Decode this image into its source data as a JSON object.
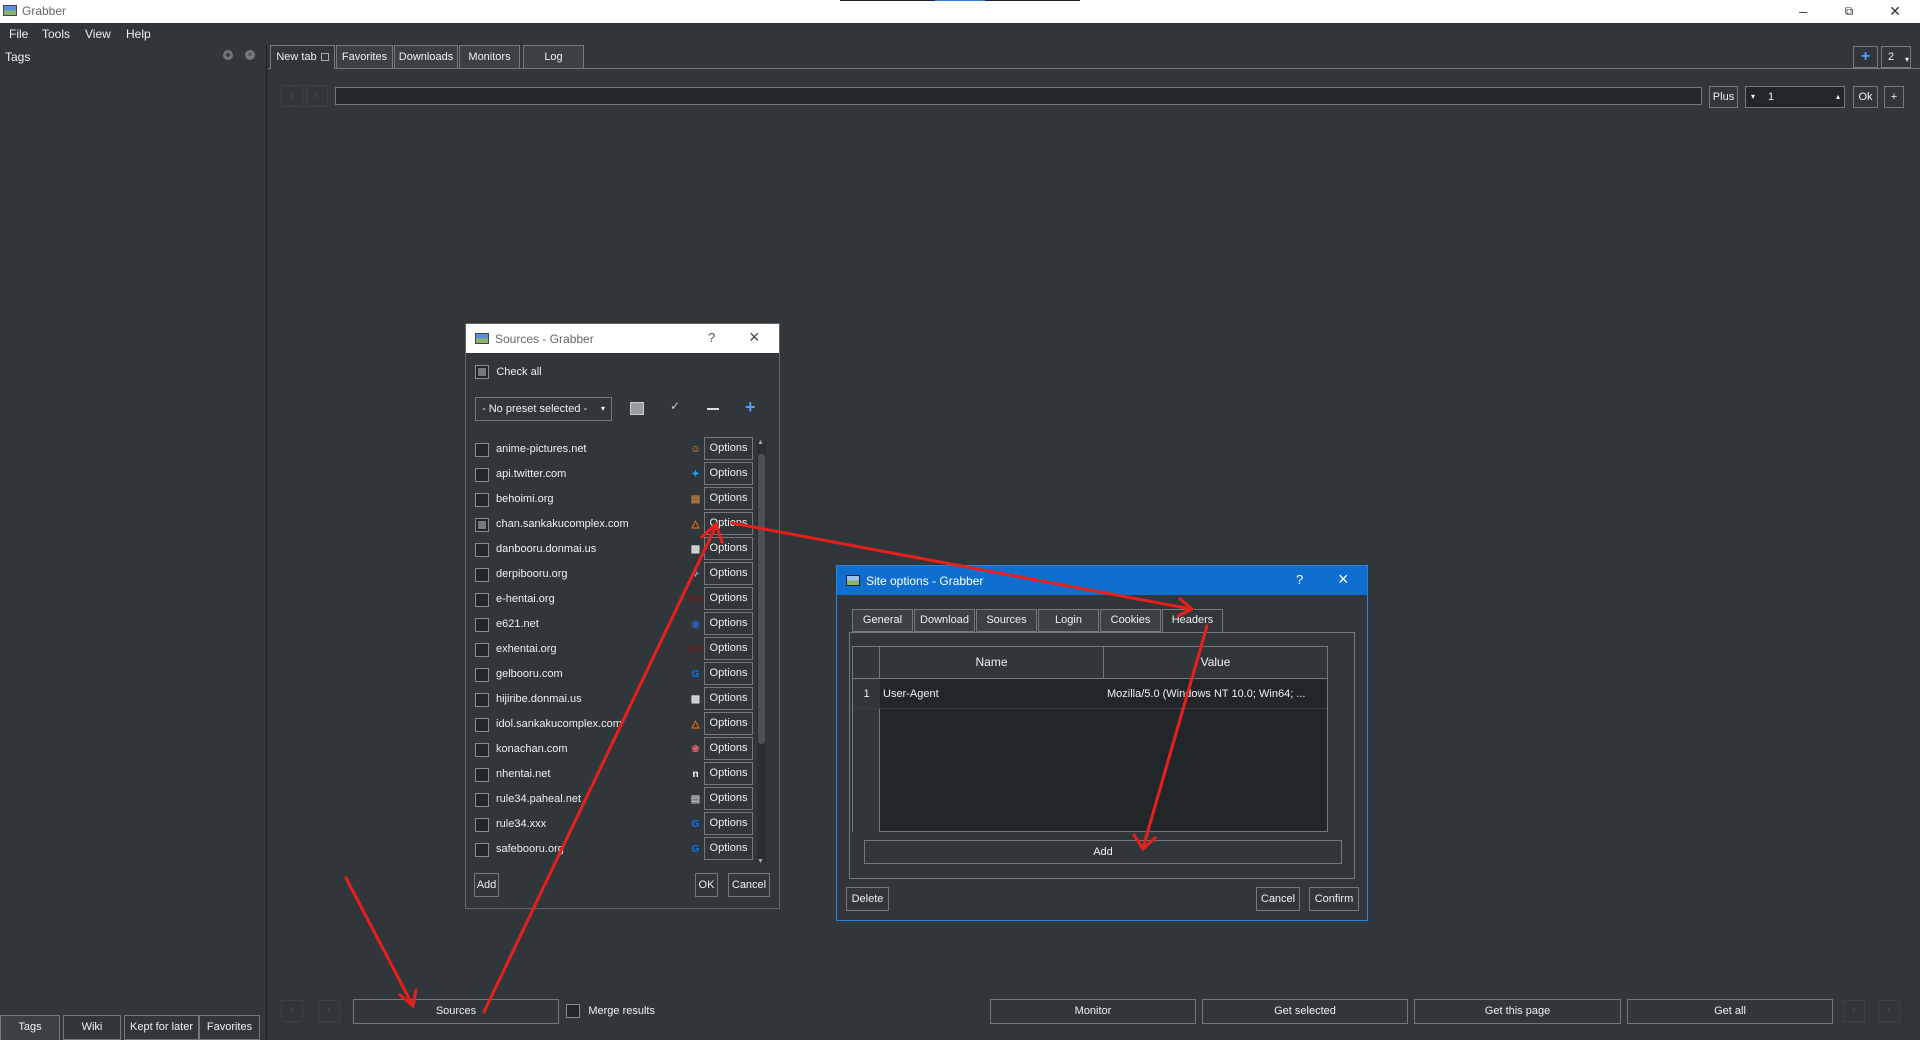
{
  "window": {
    "title": "Grabber"
  },
  "menu": [
    "File",
    "Tools",
    "View",
    "Help"
  ],
  "left_panel": {
    "header": "Tags",
    "bottom_tabs": [
      "Tags",
      "Wiki",
      "Kept for later",
      "Favorites"
    ]
  },
  "tabs": [
    "New tab",
    "Favorites",
    "Downloads",
    "Monitors",
    "Log"
  ],
  "tab_count": "2",
  "search": {
    "value": "",
    "plus_label": "Plus",
    "page": "1",
    "ok_label": "Ok",
    "add_label": "+"
  },
  "bottom_bar": {
    "sources_label": "Sources",
    "merge_label": "Merge results",
    "monitor_label": "Monitor",
    "get_selected_label": "Get selected",
    "get_page_label": "Get this page",
    "get_all_label": "Get all"
  },
  "sources_dialog": {
    "title": "Sources - Grabber",
    "help": "?",
    "check_all_label": "Check all",
    "preset": "- No preset selected -",
    "option_label": "Options",
    "add_label": "Add",
    "ok_label": "OK",
    "cancel_label": "Cancel",
    "sites": [
      {
        "name": "anime-pictures.net",
        "icon": "☺",
        "icon_color": "#f0a030"
      },
      {
        "name": "api.twitter.com",
        "icon": "✦",
        "icon_color": "#1da1f2"
      },
      {
        "name": "behoimi.org",
        "icon": "▤",
        "icon_color": "#c88040"
      },
      {
        "name": "chan.sankakucomplex.com",
        "icon": "△",
        "icon_color": "#ff7a00"
      },
      {
        "name": "danbooru.donmai.us",
        "icon": "▩",
        "icon_color": "#dddddd"
      },
      {
        "name": "derpibooru.org",
        "icon": "✧",
        "icon_color": "#8fa8d8"
      },
      {
        "name": "e-hentai.org",
        "icon": "EH",
        "icon_color": "#6b1a1a"
      },
      {
        "name": "e621.net",
        "icon": "◉",
        "icon_color": "#2b5db5"
      },
      {
        "name": "exhentai.org",
        "icon": "EH",
        "icon_color": "#6b1a1a"
      },
      {
        "name": "gelbooru.com",
        "icon": "G",
        "icon_color": "#0773fb"
      },
      {
        "name": "hijiribe.donmai.us",
        "icon": "▩",
        "icon_color": "#dddddd"
      },
      {
        "name": "idol.sankakucomplex.com",
        "icon": "△",
        "icon_color": "#ff7a00"
      },
      {
        "name": "konachan.com",
        "icon": "❀",
        "icon_color": "#e06070"
      },
      {
        "name": "nhentai.net",
        "icon": "n",
        "icon_color": "#ffffff"
      },
      {
        "name": "rule34.paheal.net",
        "icon": "▤",
        "icon_color": "#bbbbbb"
      },
      {
        "name": "rule34.xxx",
        "icon": "G",
        "icon_color": "#0773fb"
      },
      {
        "name": "safebooru.org",
        "icon": "G",
        "icon_color": "#0773fb"
      }
    ]
  },
  "site_options": {
    "title": "Site options - Grabber",
    "help": "?",
    "tabs": [
      "General",
      "Download",
      "Sources",
      "Login",
      "Cookies",
      "Headers"
    ],
    "columns": [
      "Name",
      "Value"
    ],
    "rows": [
      {
        "num": "1",
        "name": "User-Agent",
        "value": "Mozilla/5.0 (Windows NT 10.0; Win64; ..."
      }
    ],
    "add_label": "Add",
    "delete_label": "Delete",
    "cancel_label": "Cancel",
    "confirm_label": "Confirm"
  },
  "colors": {
    "background": "#31363b",
    "accent": "#2a82da",
    "annotation": "#e8201c"
  }
}
